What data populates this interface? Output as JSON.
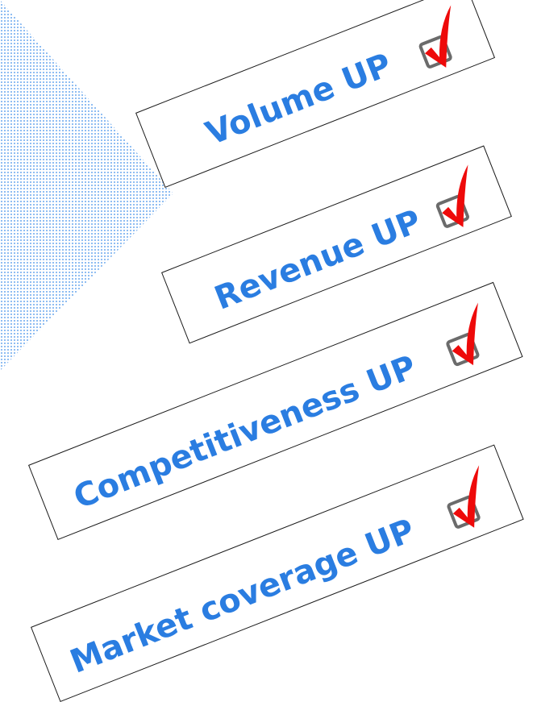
{
  "items": [
    {
      "label": "Volume UP"
    },
    {
      "label": "Revenue UP"
    },
    {
      "label": "Competitiveness UP"
    },
    {
      "label": "Market coverage UP"
    }
  ],
  "colors": {
    "text": "#2a7de1",
    "check": "#ee0a0a",
    "checkbox": "#6b6b6b",
    "dots": "#3f8ee8"
  }
}
